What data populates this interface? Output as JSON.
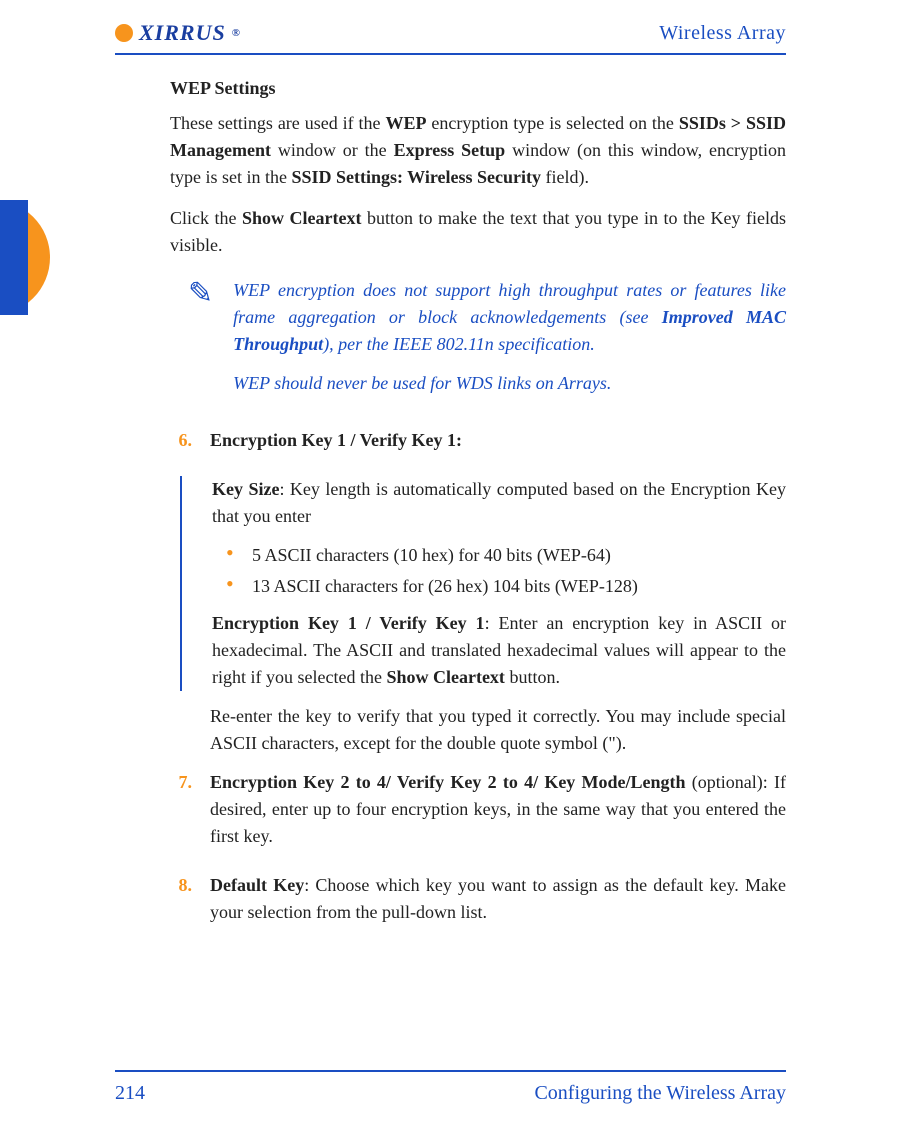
{
  "header": {
    "brand": "XIRRUS",
    "doc_title": "Wireless Array"
  },
  "section_title": "WEP Settings",
  "intro": {
    "p1_a": "These settings are used if the ",
    "p1_b": "WEP",
    "p1_c": " encryption type is selected on the ",
    "p1_d": "SSIDs > SSID Management",
    "p1_e": " window or the ",
    "p1_f": "Express Setup",
    "p1_g": " window (on this window, encryption type is set in the ",
    "p1_h": "SSID Settings: Wireless Security",
    "p1_i": " field).",
    "p2_a": "Click the ",
    "p2_b": "Show Cleartext",
    "p2_c": " button to make the text that you type in to the Key fields visible."
  },
  "note": {
    "icon": "✎",
    "n1_a": "WEP encryption does not support high throughput rates or features like frame aggregation or block acknowledgements (see ",
    "n1_b": "Improved MAC Throughput",
    "n1_c": "), per the IEEE 802.11n specification.",
    "n2": "WEP should never be used for WDS links on Arrays."
  },
  "steps": {
    "s6": {
      "num": "6.",
      "title": "Encryption Key 1 / Verify Key 1:",
      "ks_a": "Key Size",
      "ks_b": ": Key length is automatically computed based on the Encryption Key that you enter",
      "b1": "5 ASCII characters (10 hex) for 40 bits (WEP-64)",
      "b2": "13 ASCII characters for (26 hex) 104 bits (WEP-128)",
      "ek_a": "Encryption Key 1 / Verify Key 1",
      "ek_b": ": Enter an encryption key in ASCII or hexadecimal. The ASCII and translated hexadecimal values will appear to the right if you selected the ",
      "ek_c": "Show Cleartext",
      "ek_d": " button.",
      "re": "Re-enter the key to verify that you typed it correctly. You may include special ASCII characters, except for the double quote symbol (\")."
    },
    "s7": {
      "num": "7.",
      "t_a": "Encryption Key 2 to 4/ Verify Key 2 to 4/ Key Mode/Length",
      "t_b": " (optional): If desired, enter up to four encryption keys, in the same way that you entered the first key."
    },
    "s8": {
      "num": "8.",
      "t_a": "Default Key",
      "t_b": ": Choose which key you want to assign as the default key. Make your selection from the pull-down list."
    }
  },
  "footer": {
    "page": "214",
    "section": "Configuring the Wireless Array"
  }
}
